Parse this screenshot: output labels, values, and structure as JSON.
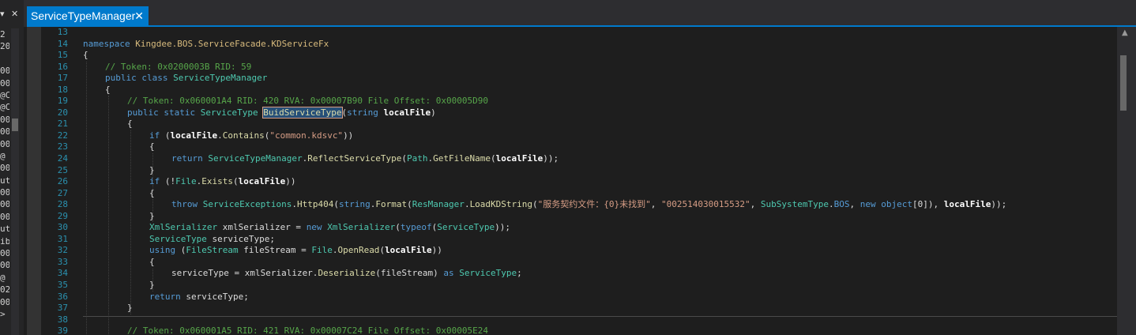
{
  "left_panel": {
    "top_glyphs": [
      "▾",
      "✕"
    ],
    "fragments": [
      "2",
      "20",
      "",
      "00",
      "00",
      "@C",
      "@C",
      "00",
      "00",
      "00",
      "@",
      "00",
      "ute",
      "00",
      "00",
      "00",
      "ute",
      "ib",
      "00",
      "00",
      "@",
      "02",
      "00",
      ">"
    ]
  },
  "tab": {
    "title": "ServiceTypeManager",
    "close_glyph": "✕"
  },
  "scrollbar": {
    "up_arrow": "▲"
  },
  "colors": {
    "accent": "#007acc",
    "background": "#1e1e1e",
    "keyword": "#569cd6",
    "type": "#4ec9b0",
    "method": "#dcdcaa",
    "comment": "#57a64a",
    "string": "#d69d85",
    "line_number": "#2b91af"
  },
  "lines": [
    {
      "n": "13",
      "indent": 0,
      "tokens": []
    },
    {
      "n": "14",
      "indent": 0,
      "tokens": [
        {
          "t": "namespace ",
          "c": "kw"
        },
        {
          "t": "Kingdee.BOS.ServiceFacade.KDServiceFx",
          "c": "ns"
        }
      ]
    },
    {
      "n": "15",
      "indent": 0,
      "tokens": [
        {
          "t": "{",
          "c": "p"
        }
      ]
    },
    {
      "n": "16",
      "indent": 1,
      "tokens": [
        {
          "t": "// Token: 0x0200003B RID: 59",
          "c": "comment"
        }
      ]
    },
    {
      "n": "17",
      "indent": 1,
      "tokens": [
        {
          "t": "public ",
          "c": "kw"
        },
        {
          "t": "class ",
          "c": "kw"
        },
        {
          "t": "ServiceTypeManager",
          "c": "type"
        }
      ]
    },
    {
      "n": "18",
      "indent": 1,
      "tokens": [
        {
          "t": "{",
          "c": "p"
        }
      ]
    },
    {
      "n": "19",
      "indent": 2,
      "tokens": [
        {
          "t": "// Token: 0x060001A4 RID: 420 RVA: 0x00007B90 File Offset: 0x00005D90",
          "c": "comment"
        }
      ]
    },
    {
      "n": "20",
      "indent": 2,
      "tokens": [
        {
          "t": "public ",
          "c": "kw"
        },
        {
          "t": "static ",
          "c": "kw"
        },
        {
          "t": "ServiceType ",
          "c": "type"
        },
        {
          "t": "BuidServiceType",
          "c": "method",
          "hl": true
        },
        {
          "t": "(",
          "c": "p"
        },
        {
          "t": "string ",
          "c": "kw"
        },
        {
          "t": "localFile",
          "c": "param"
        },
        {
          "t": ")",
          "c": "p"
        }
      ]
    },
    {
      "n": "21",
      "indent": 2,
      "tokens": [
        {
          "t": "{",
          "c": "p"
        }
      ]
    },
    {
      "n": "22",
      "indent": 3,
      "tokens": [
        {
          "t": "if ",
          "c": "kw"
        },
        {
          "t": "(",
          "c": "p"
        },
        {
          "t": "localFile",
          "c": "param"
        },
        {
          "t": ".",
          "c": "p"
        },
        {
          "t": "Contains",
          "c": "method"
        },
        {
          "t": "(",
          "c": "p"
        },
        {
          "t": "\"common.kdsvc\"",
          "c": "str"
        },
        {
          "t": "))",
          "c": "p"
        }
      ]
    },
    {
      "n": "23",
      "indent": 3,
      "tokens": [
        {
          "t": "{",
          "c": "p"
        }
      ]
    },
    {
      "n": "24",
      "indent": 4,
      "tokens": [
        {
          "t": "return ",
          "c": "kw"
        },
        {
          "t": "ServiceTypeManager",
          "c": "type"
        },
        {
          "t": ".",
          "c": "p"
        },
        {
          "t": "ReflectServiceType",
          "c": "method"
        },
        {
          "t": "(",
          "c": "p"
        },
        {
          "t": "Path",
          "c": "type"
        },
        {
          "t": ".",
          "c": "p"
        },
        {
          "t": "GetFileName",
          "c": "method"
        },
        {
          "t": "(",
          "c": "p"
        },
        {
          "t": "localFile",
          "c": "param"
        },
        {
          "t": "));",
          "c": "p"
        }
      ]
    },
    {
      "n": "25",
      "indent": 3,
      "tokens": [
        {
          "t": "}",
          "c": "p"
        }
      ]
    },
    {
      "n": "26",
      "indent": 3,
      "tokens": [
        {
          "t": "if ",
          "c": "kw"
        },
        {
          "t": "(!",
          "c": "p"
        },
        {
          "t": "File",
          "c": "type"
        },
        {
          "t": ".",
          "c": "p"
        },
        {
          "t": "Exists",
          "c": "method"
        },
        {
          "t": "(",
          "c": "p"
        },
        {
          "t": "localFile",
          "c": "param"
        },
        {
          "t": "))",
          "c": "p"
        }
      ]
    },
    {
      "n": "27",
      "indent": 3,
      "tokens": [
        {
          "t": "{",
          "c": "p"
        }
      ]
    },
    {
      "n": "28",
      "indent": 4,
      "tokens": [
        {
          "t": "throw ",
          "c": "kw"
        },
        {
          "t": "ServiceExceptions",
          "c": "type"
        },
        {
          "t": ".",
          "c": "p"
        },
        {
          "t": "Http404",
          "c": "method"
        },
        {
          "t": "(",
          "c": "p"
        },
        {
          "t": "string",
          "c": "kw"
        },
        {
          "t": ".",
          "c": "p"
        },
        {
          "t": "Format",
          "c": "method"
        },
        {
          "t": "(",
          "c": "p"
        },
        {
          "t": "ResManager",
          "c": "type"
        },
        {
          "t": ".",
          "c": "p"
        },
        {
          "t": "LoadKDString",
          "c": "method"
        },
        {
          "t": "(",
          "c": "p"
        },
        {
          "t": "\"服务契约文件：{0}未找到\"",
          "c": "str"
        },
        {
          "t": ", ",
          "c": "p"
        },
        {
          "t": "\"002514030015532\"",
          "c": "str"
        },
        {
          "t": ", ",
          "c": "p"
        },
        {
          "t": "SubSystemType",
          "c": "type"
        },
        {
          "t": ".",
          "c": "p"
        },
        {
          "t": "BOS",
          "c": "kw"
        },
        {
          "t": ", ",
          "c": "p"
        },
        {
          "t": "new ",
          "c": "kw"
        },
        {
          "t": "object",
          "c": "kw"
        },
        {
          "t": "[0]), ",
          "c": "p"
        },
        {
          "t": "localFile",
          "c": "param"
        },
        {
          "t": "));",
          "c": "p"
        }
      ]
    },
    {
      "n": "29",
      "indent": 3,
      "tokens": [
        {
          "t": "}",
          "c": "p"
        }
      ]
    },
    {
      "n": "30",
      "indent": 3,
      "tokens": [
        {
          "t": "XmlSerializer ",
          "c": "type"
        },
        {
          "t": "xmlSerializer = ",
          "c": "p"
        },
        {
          "t": "new ",
          "c": "kw"
        },
        {
          "t": "XmlSerializer",
          "c": "type"
        },
        {
          "t": "(",
          "c": "p"
        },
        {
          "t": "typeof",
          "c": "kw"
        },
        {
          "t": "(",
          "c": "p"
        },
        {
          "t": "ServiceType",
          "c": "type"
        },
        {
          "t": "));",
          "c": "p"
        }
      ]
    },
    {
      "n": "31",
      "indent": 3,
      "tokens": [
        {
          "t": "ServiceType ",
          "c": "type"
        },
        {
          "t": "serviceType;",
          "c": "p"
        }
      ]
    },
    {
      "n": "32",
      "indent": 3,
      "tokens": [
        {
          "t": "using ",
          "c": "kw"
        },
        {
          "t": "(",
          "c": "p"
        },
        {
          "t": "FileStream ",
          "c": "type"
        },
        {
          "t": "fileStream = ",
          "c": "p"
        },
        {
          "t": "File",
          "c": "type"
        },
        {
          "t": ".",
          "c": "p"
        },
        {
          "t": "OpenRead",
          "c": "method"
        },
        {
          "t": "(",
          "c": "p"
        },
        {
          "t": "localFile",
          "c": "param"
        },
        {
          "t": "))",
          "c": "p"
        }
      ]
    },
    {
      "n": "33",
      "indent": 3,
      "tokens": [
        {
          "t": "{",
          "c": "p"
        }
      ]
    },
    {
      "n": "34",
      "indent": 4,
      "tokens": [
        {
          "t": "serviceType = xmlSerializer.",
          "c": "p"
        },
        {
          "t": "Deserialize",
          "c": "method"
        },
        {
          "t": "(fileStream) ",
          "c": "p"
        },
        {
          "t": "as ",
          "c": "kw"
        },
        {
          "t": "ServiceType",
          "c": "type"
        },
        {
          "t": ";",
          "c": "p"
        }
      ]
    },
    {
      "n": "35",
      "indent": 3,
      "tokens": [
        {
          "t": "}",
          "c": "p"
        }
      ]
    },
    {
      "n": "36",
      "indent": 3,
      "tokens": [
        {
          "t": "return ",
          "c": "kw"
        },
        {
          "t": "serviceType;",
          "c": "p"
        }
      ]
    },
    {
      "n": "37",
      "indent": 2,
      "tokens": [
        {
          "t": "}",
          "c": "p"
        }
      ]
    },
    {
      "n": "38",
      "indent": 0,
      "tokens": []
    },
    {
      "n": "39",
      "indent": 2,
      "tokens": [
        {
          "t": "// Token: 0x060001A5 RID: 421 RVA: 0x00007C24 File Offset: 0x00005E24",
          "c": "comment"
        }
      ]
    }
  ]
}
